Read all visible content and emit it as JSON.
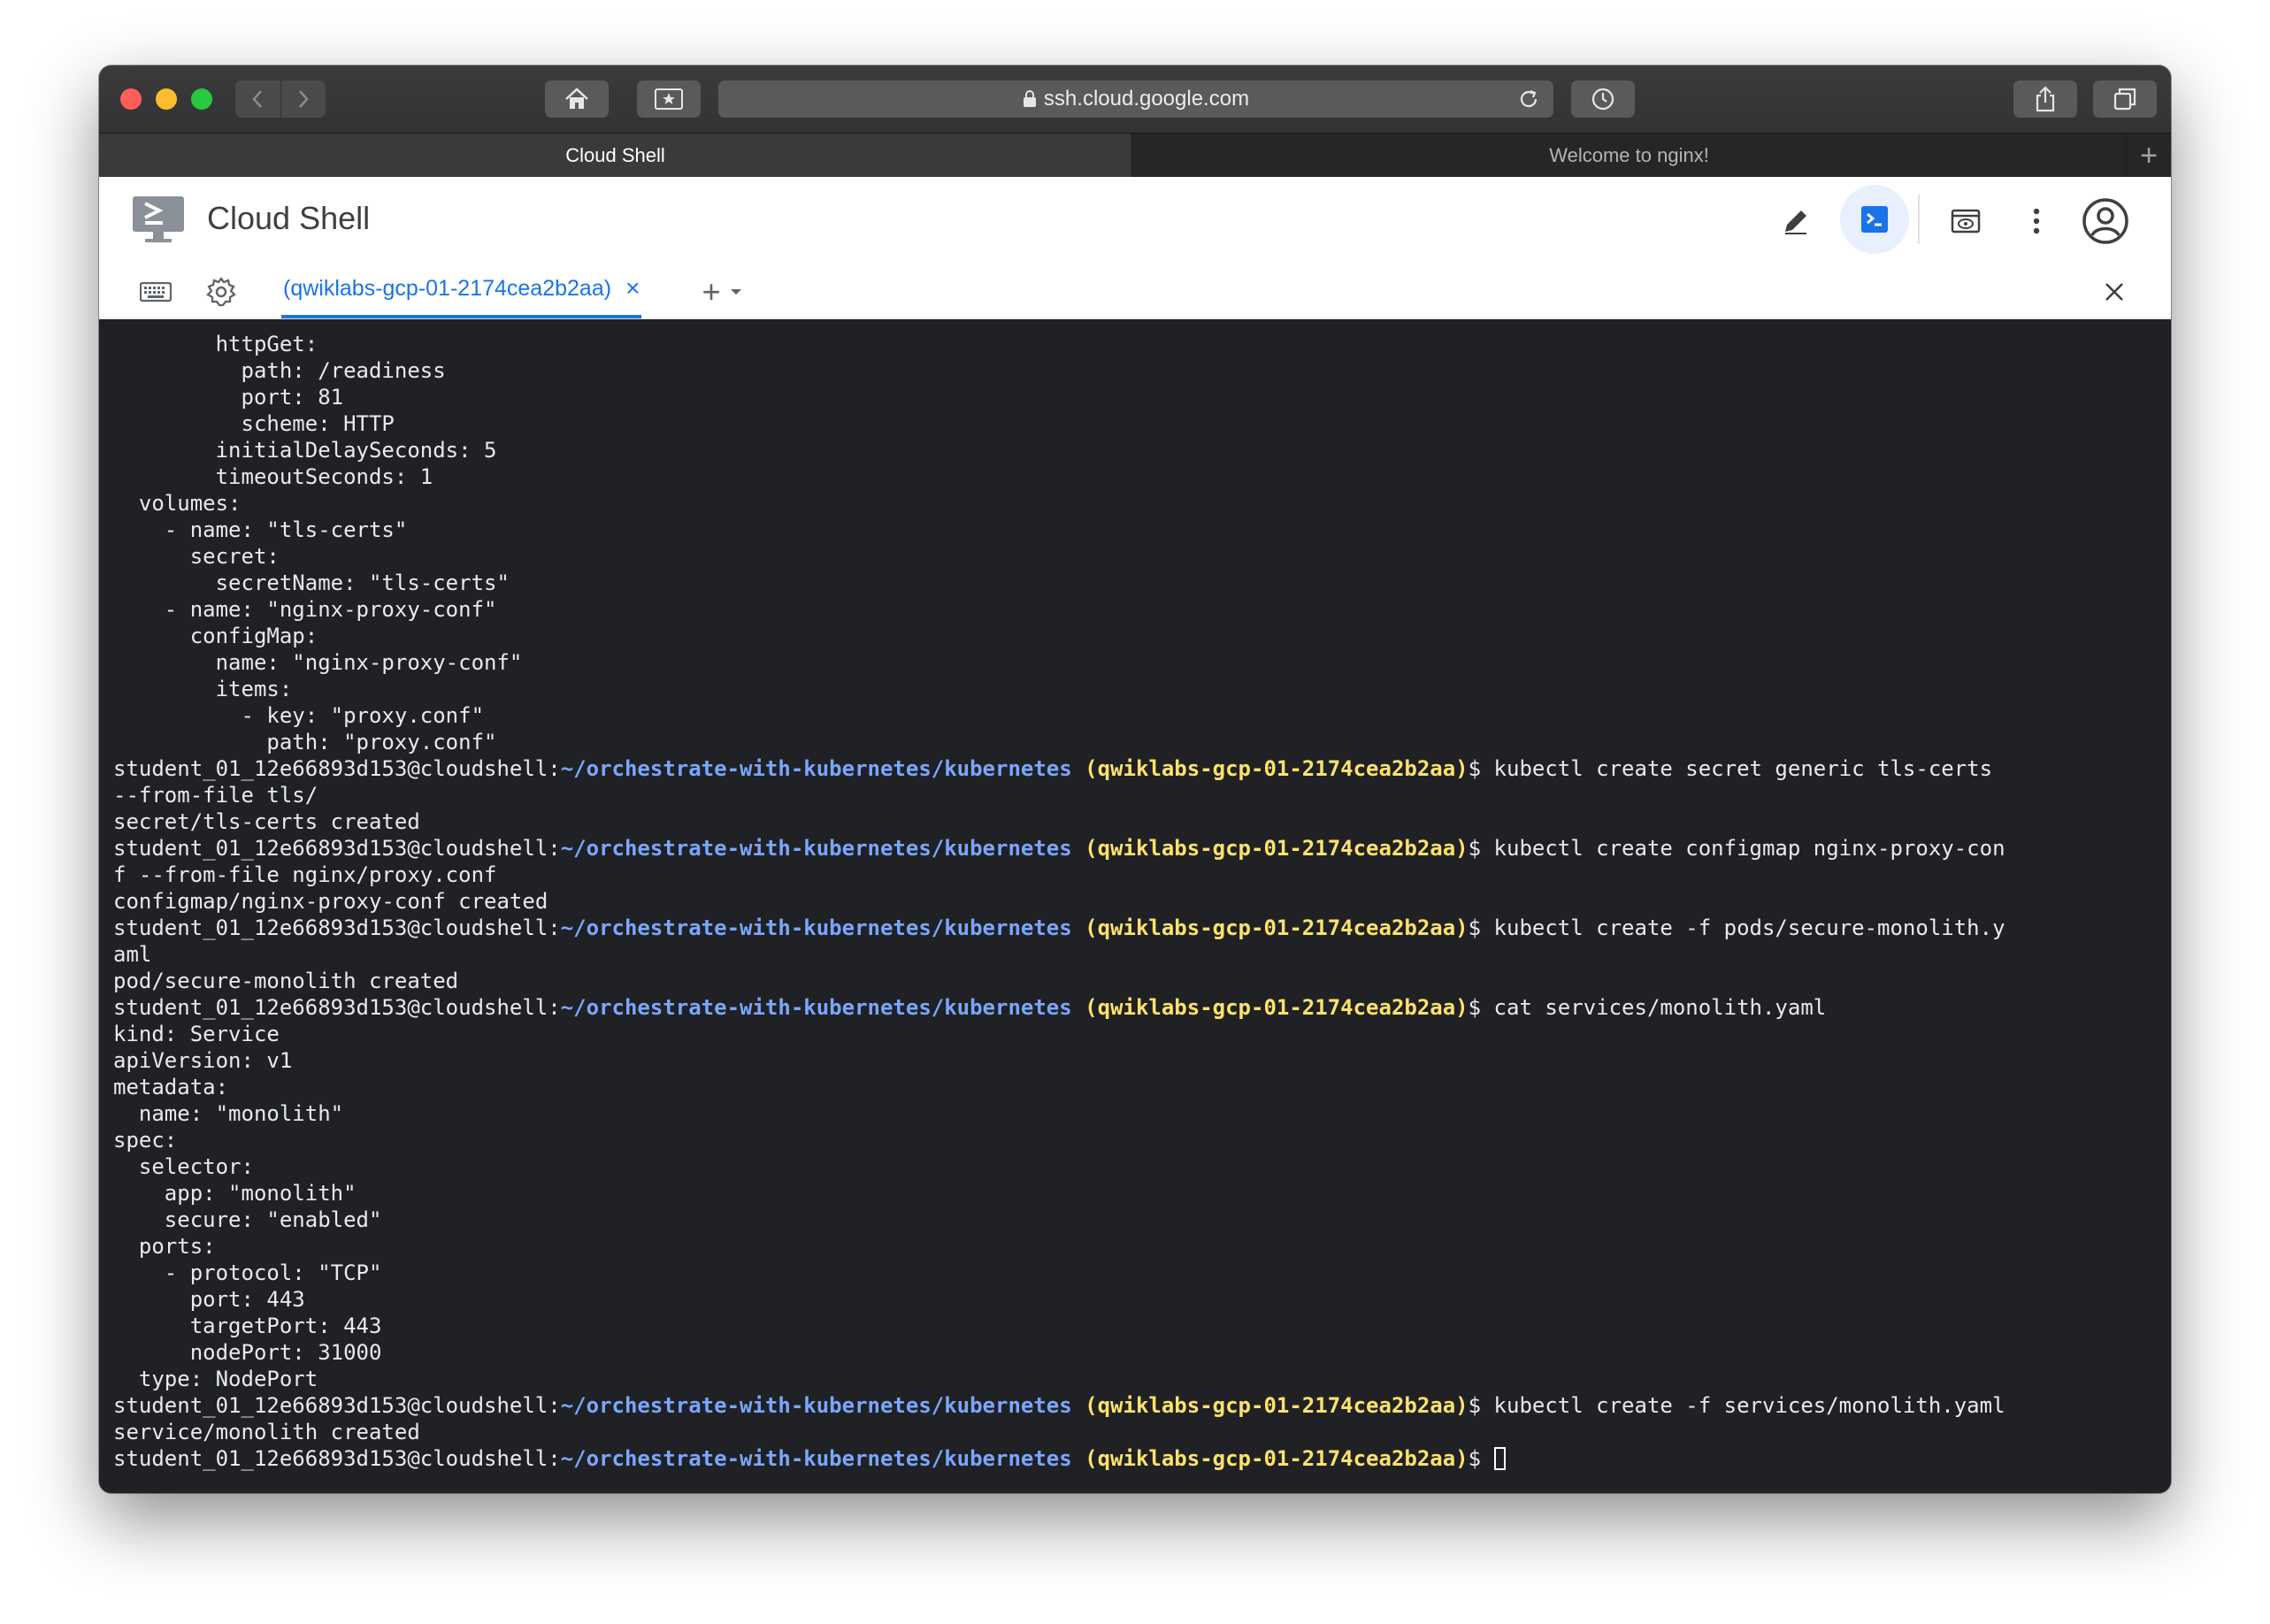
{
  "browser": {
    "url": "ssh.cloud.google.com",
    "tabs": [
      {
        "label": "Cloud Shell",
        "active": true
      },
      {
        "label": "Welcome to nginx!",
        "active": false
      }
    ],
    "new_tab_label": "+"
  },
  "header": {
    "title": "Cloud Shell"
  },
  "terminal_tab": {
    "label": "(qwiklabs-gcp-01-2174cea2b2aa)",
    "close_label": "×",
    "add_label": "+"
  },
  "prompt": {
    "user": "student_01_12e66893d153@cloudshell:",
    "path": "~/orchestrate-with-kubernetes/kubernetes",
    "project": "(qwiklabs-gcp-01-2174cea2b2aa)",
    "dollar": "$ "
  },
  "terminal_lines": [
    {
      "type": "out",
      "text": "        httpGet:"
    },
    {
      "type": "out",
      "text": "          path: /readiness"
    },
    {
      "type": "out",
      "text": "          port: 81"
    },
    {
      "type": "out",
      "text": "          scheme: HTTP"
    },
    {
      "type": "out",
      "text": "        initialDelaySeconds: 5"
    },
    {
      "type": "out",
      "text": "        timeoutSeconds: 1"
    },
    {
      "type": "out",
      "text": "  volumes:"
    },
    {
      "type": "out",
      "text": "    - name: \"tls-certs\""
    },
    {
      "type": "out",
      "text": "      secret:"
    },
    {
      "type": "out",
      "text": "        secretName: \"tls-certs\""
    },
    {
      "type": "out",
      "text": "    - name: \"nginx-proxy-conf\""
    },
    {
      "type": "out",
      "text": "      configMap:"
    },
    {
      "type": "out",
      "text": "        name: \"nginx-proxy-conf\""
    },
    {
      "type": "out",
      "text": "        items:"
    },
    {
      "type": "out",
      "text": "          - key: \"proxy.conf\""
    },
    {
      "type": "out",
      "text": "            path: \"proxy.conf\""
    },
    {
      "type": "prompt",
      "text": "kubectl create secret generic tls-certs"
    },
    {
      "type": "out",
      "text": "--from-file tls/"
    },
    {
      "type": "out",
      "text": "secret/tls-certs created"
    },
    {
      "type": "prompt",
      "text": "kubectl create configmap nginx-proxy-con"
    },
    {
      "type": "out",
      "text": "f --from-file nginx/proxy.conf"
    },
    {
      "type": "out",
      "text": "configmap/nginx-proxy-conf created"
    },
    {
      "type": "prompt",
      "text": "kubectl create -f pods/secure-monolith.y"
    },
    {
      "type": "out",
      "text": "aml"
    },
    {
      "type": "out",
      "text": "pod/secure-monolith created"
    },
    {
      "type": "prompt",
      "text": "cat services/monolith.yaml"
    },
    {
      "type": "out",
      "text": "kind: Service"
    },
    {
      "type": "out",
      "text": "apiVersion: v1"
    },
    {
      "type": "out",
      "text": "metadata:"
    },
    {
      "type": "out",
      "text": "  name: \"monolith\""
    },
    {
      "type": "out",
      "text": "spec:"
    },
    {
      "type": "out",
      "text": "  selector:"
    },
    {
      "type": "out",
      "text": "    app: \"monolith\""
    },
    {
      "type": "out",
      "text": "    secure: \"enabled\""
    },
    {
      "type": "out",
      "text": "  ports:"
    },
    {
      "type": "out",
      "text": "    - protocol: \"TCP\""
    },
    {
      "type": "out",
      "text": "      port: 443"
    },
    {
      "type": "out",
      "text": "      targetPort: 443"
    },
    {
      "type": "out",
      "text": "      nodePort: 31000"
    },
    {
      "type": "out",
      "text": "  type: NodePort"
    },
    {
      "type": "prompt",
      "text": "kubectl create -f services/monolith.yaml"
    },
    {
      "type": "out",
      "text": "service/monolith created"
    },
    {
      "type": "prompt",
      "text": "",
      "cursor": true
    }
  ],
  "colors": {
    "terminal_bg": "#202124",
    "prompt_path": "#7aa6ff",
    "prompt_project": "#fde26b",
    "accent": "#1a73e8"
  }
}
